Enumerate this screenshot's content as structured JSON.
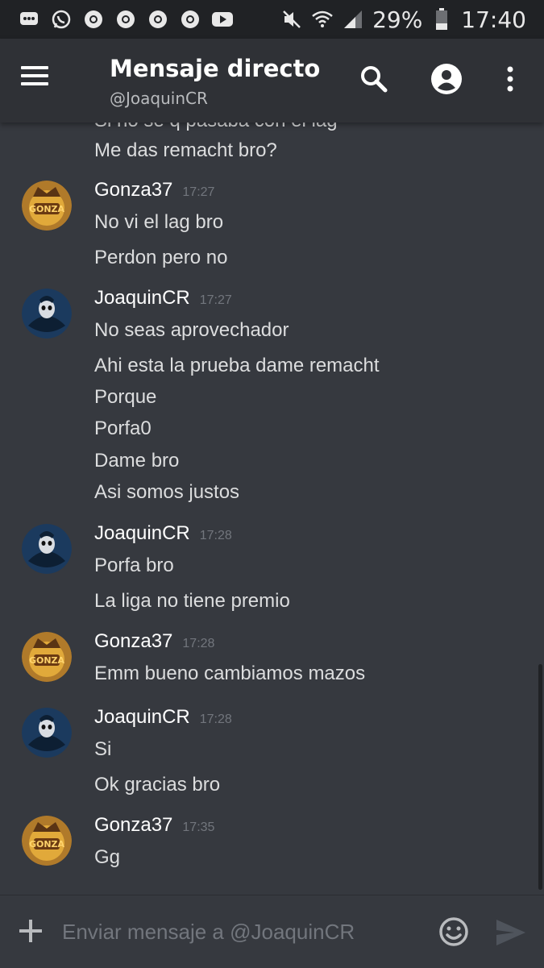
{
  "status_bar": {
    "battery_percent": "29%",
    "time": "17:40",
    "notification_icons": [
      "chat-bubble-icon",
      "whatsapp-icon",
      "chrome-icon",
      "chrome-icon",
      "chrome-icon",
      "chrome-icon",
      "youtube-icon"
    ],
    "system_icons": [
      "mute-icon",
      "wifi-icon",
      "signal-icon",
      "battery-icon"
    ]
  },
  "app_bar": {
    "title": "Mensaje directo",
    "subtitle": "@JoaquinCR",
    "icons": [
      "menu-icon",
      "search-icon",
      "profile-icon",
      "more-vert-icon"
    ]
  },
  "messages": {
    "partial_top_line": "Si no se q pasaba con el lag",
    "orphan_line": "Me das remacht bro?",
    "groups": [
      {
        "author": "Gonza37",
        "time": "17:27",
        "lines": [
          "No vi el lag bro",
          "Perdon pero no"
        ]
      },
      {
        "author": "JoaquinCR",
        "time": "17:27",
        "lines": [
          "No seas aprovechador",
          "Ahi esta la prueba dame remacht",
          "Porque",
          "Porfa0",
          "Dame bro",
          "Asi somos justos"
        ]
      },
      {
        "author": "JoaquinCR",
        "time": "17:28",
        "lines": [
          "Porfa bro",
          "La liga no tiene premio"
        ]
      },
      {
        "author": "Gonza37",
        "time": "17:28",
        "lines": [
          "Emm bueno cambiamos mazos"
        ]
      },
      {
        "author": "JoaquinCR",
        "time": "17:28",
        "lines": [
          "Si",
          "Ok gracias bro"
        ]
      },
      {
        "author": "Gonza37",
        "time": "17:35",
        "lines": [
          "Gg"
        ]
      }
    ]
  },
  "composer": {
    "placeholder": "Enviar mensaje a @JoaquinCR"
  },
  "colors": {
    "background": "#36393f",
    "app_bar": "#2f3136",
    "status_bar": "#202225",
    "text": "#dcddde",
    "muted": "#72767d"
  }
}
